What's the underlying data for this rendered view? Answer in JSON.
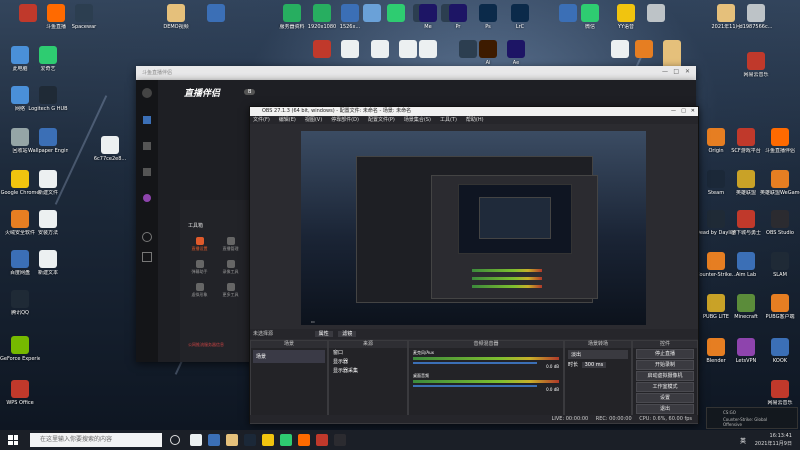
{
  "desktop": {
    "top_icons": [
      {
        "label": "",
        "color": "#c0392b"
      },
      {
        "label": "斗鱼直播",
        "color": "#ff6a00"
      },
      {
        "label": "Spacewar",
        "color": "#2c3e50"
      },
      {
        "label": "DEMO视频",
        "color": "#e5c07b"
      },
      {
        "label": "",
        "color": "#3b6fb6"
      },
      {
        "label": "服务器资料",
        "color": "#27ae60"
      },
      {
        "label": "1920x1080",
        "color": "#27ae60"
      },
      {
        "label": "1526x...",
        "color": "#3b6fb6"
      },
      {
        "label": "",
        "color": "#6aa1d8"
      },
      {
        "label": "",
        "color": "#2ecc71"
      },
      {
        "label": "",
        "color": "#2c3e50"
      },
      {
        "label": "",
        "color": "#2c3e50"
      },
      {
        "label": "Me",
        "color": "#1d1565"
      },
      {
        "label": "Pr",
        "color": "#1d1565"
      },
      {
        "label": "Ps",
        "color": "#0b2a4a"
      },
      {
        "label": "LrC",
        "color": "#0b2a4a"
      },
      {
        "label": "",
        "color": "#3b6fb6"
      },
      {
        "label": "微信",
        "color": "#2ecc71"
      },
      {
        "label": "YY语音",
        "color": "#f1c40f"
      },
      {
        "label": "",
        "color": "#bdc3c7"
      },
      {
        "label": "2021年11月",
        "color": "#e5c07b"
      },
      {
        "label": "d1987566c...",
        "color": "#bdc3c7"
      }
    ],
    "second_row": [
      {
        "label": "",
        "color": "#c0392b"
      },
      {
        "label": "",
        "color": "#ecf0f1"
      },
      {
        "label": "",
        "color": "#ecf0f1"
      },
      {
        "label": "",
        "color": "#ecf0f1"
      },
      {
        "label": "",
        "color": "#ecf0f1"
      },
      {
        "label": "",
        "color": "#2c3e50"
      },
      {
        "label": "Ai",
        "color": "#3d1b00"
      },
      {
        "label": "Ae",
        "color": "#1d1565"
      },
      {
        "label": "",
        "color": "#ecf0f1"
      },
      {
        "label": "",
        "color": "#e67e22"
      },
      {
        "label": "",
        "color": "#e5c07b"
      },
      {
        "label": "本地金融信息",
        "color": "#e5c07b"
      },
      {
        "label": "网易云音乐",
        "color": "#c0392b"
      }
    ],
    "left_icons": [
      {
        "label": "此电脑",
        "color": "#4a90d9"
      },
      {
        "label": "爱奇艺",
        "color": "#2ecc71"
      },
      {
        "label": "网络",
        "color": "#4a90d9"
      },
      {
        "label": "Logitech G HUB",
        "color": "#1f2a36"
      },
      {
        "label": "回收站",
        "color": "#95a5a6"
      },
      {
        "label": "Wallpaper Engine",
        "color": "#3b6fb6"
      },
      {
        "label": "6c77ce2e8...",
        "color": "#ecf0f1"
      },
      {
        "label": "Google Chrome",
        "color": "#f1c40f"
      },
      {
        "label": "新建文件",
        "color": "#ecf0f1"
      },
      {
        "label": "火绒安全软件",
        "color": "#e67e22"
      },
      {
        "label": "安装方法",
        "color": "#ecf0f1"
      },
      {
        "label": "百度网盘",
        "color": "#3b6fb6"
      },
      {
        "label": "新建文本",
        "color": "#ecf0f1"
      },
      {
        "label": "腾讯QQ",
        "color": "#1f2a36"
      },
      {
        "label": "GeForce Experience",
        "color": "#76b900"
      },
      {
        "label": "WPS Office",
        "color": "#c0392b"
      }
    ],
    "right_icons": [
      {
        "label": "Origin",
        "color": "#e67e22"
      },
      {
        "label": "SCF游戏平台",
        "color": "#c0392b"
      },
      {
        "label": "斗鱼直播伴侣",
        "color": "#ff6a00"
      },
      {
        "label": "Steam",
        "color": "#1b2838"
      },
      {
        "label": "英雄联盟",
        "color": "#c9a227"
      },
      {
        "label": "英雄联盟WeGame",
        "color": "#e67e22"
      },
      {
        "label": "Dead by Daylight",
        "color": "#1f2a36"
      },
      {
        "label": "地下城与勇士",
        "color": "#c0392b"
      },
      {
        "label": "OBS Studio",
        "color": "#2b2b30"
      },
      {
        "label": "Counter-Strike...",
        "color": "#e67e22"
      },
      {
        "label": "Aim Lab",
        "color": "#3b6fb6"
      },
      {
        "label": "SLAM",
        "color": "#1f2a36"
      },
      {
        "label": "PUBG LITE",
        "color": "#c9a227"
      },
      {
        "label": "Minecraft",
        "color": "#5b8c3a"
      },
      {
        "label": "PUBG客户端",
        "color": "#e67e22"
      },
      {
        "label": "Blender",
        "color": "#e67e22"
      },
      {
        "label": "LetsVPN",
        "color": "#8e44ad"
      },
      {
        "label": "KOOK",
        "color": "#3b6fb6"
      },
      {
        "label": "网易云音乐",
        "color": "#c0392b"
      }
    ]
  },
  "douyu_window": {
    "title": "斗鱼直播伴侣",
    "app_name": "直播伴侣",
    "badge": "B",
    "sidebar_label": "工具箱",
    "tools": [
      {
        "label": "直播设置",
        "active": true
      },
      {
        "label": "直播管理",
        "active": false
      },
      {
        "label": "弹幕助手",
        "active": false
      },
      {
        "label": "录像工具",
        "active": false
      },
      {
        "label": "虚拟形象",
        "active": false
      },
      {
        "label": "更多工具",
        "active": false
      }
    ],
    "notice": "公网推流服务器信息"
  },
  "obs": {
    "title": "OBS 27.1.3 (64 bit, windows) - 配置文件: 未命名 - 场景: 未命名",
    "menu": [
      "文件(F)",
      "编辑(E)",
      "视图(V)",
      "停靠部件(D)",
      "配置文件(P)",
      "场景集合(S)",
      "工具(T)",
      "帮助(H)"
    ],
    "status_row_label": "未选择源",
    "properties_btn": "属性",
    "filters_btn": "滤镜",
    "panels": {
      "scenes": {
        "title": "场景",
        "items": [
          "场景"
        ]
      },
      "sources": {
        "title": "来源",
        "items": [
          "窗口",
          "显示器",
          "显示器采集"
        ]
      },
      "mixer": {
        "title": "音频混音器",
        "tracks": [
          {
            "name": "麦克风/Aux",
            "db": "0.0 dB"
          },
          {
            "name": "桌面音频",
            "db": "0.0 dB"
          }
        ]
      },
      "transitions": {
        "title": "场景转场",
        "type": "淡出",
        "duration_label": "时长",
        "duration": "300 ms"
      },
      "controls": {
        "title": "控件",
        "buttons": [
          "停止直播",
          "开始录制",
          "启动虚拟摄像机",
          "工作室模式",
          "设置",
          "退出"
        ]
      }
    },
    "statusbar": {
      "live": "LIVE: 00:00:00",
      "rec": "REC: 00:00:00",
      "cpu": "CPU: 0.6%, 60.00 fps"
    }
  },
  "taskbar": {
    "search_placeholder": "在这里输入你要搜索的内容",
    "time": "16:13:41",
    "date": "2021年11月9日",
    "lang": "英",
    "apps": [
      {
        "color": "#ecf0f1"
      },
      {
        "color": "#3b6fb6"
      },
      {
        "color": "#e5c07b"
      },
      {
        "color": "#1b2838"
      },
      {
        "color": "#f1c40f"
      },
      {
        "color": "#2ecc71"
      },
      {
        "color": "#ff6a00"
      },
      {
        "color": "#c0392b"
      },
      {
        "color": "#2b2b30"
      }
    ]
  },
  "toast": {
    "title": "Counter-Strike: Global Offensive",
    "subtitle": "CS:GO"
  }
}
